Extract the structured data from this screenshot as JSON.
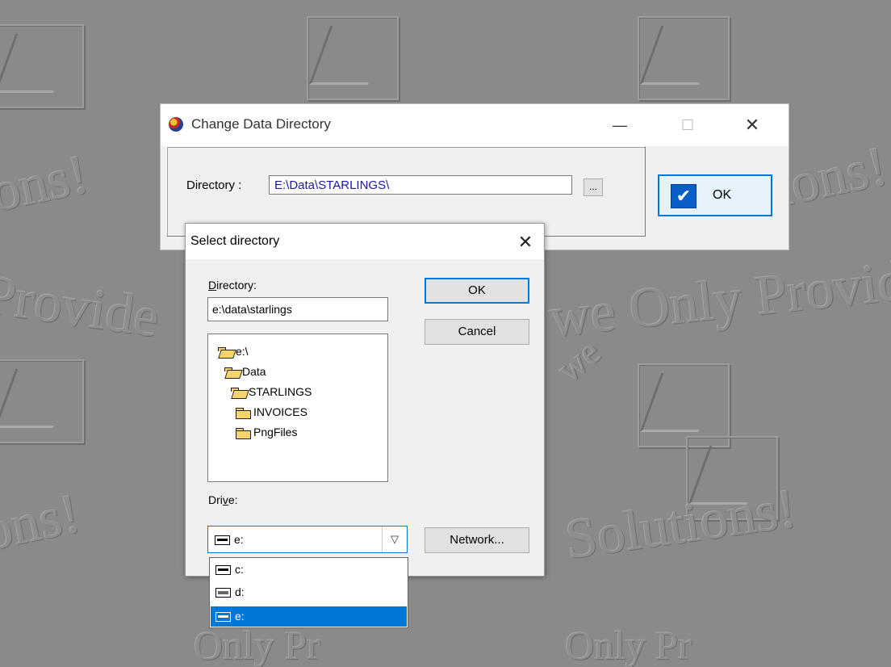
{
  "main_window": {
    "title": "Change Data Directory",
    "minimize": "—",
    "maximize": "☐",
    "close": "✕",
    "directory_label": "Directory :",
    "directory_value": "E:\\Data\\STARLINGS\\",
    "browse_label": "...",
    "ok_label": "OK"
  },
  "select_dialog": {
    "title": "Select directory",
    "close": "✕",
    "directory_label_first": "D",
    "directory_label_rest": "irectory:",
    "path_value": "e:\\data\\starlings",
    "tree": [
      {
        "label": "e:\\",
        "indent": 0,
        "icon": "folder-open-icon"
      },
      {
        "label": "Data",
        "indent": 1,
        "icon": "folder-open-icon"
      },
      {
        "label": "STARLINGS",
        "indent": 2,
        "icon": "folder-open-icon"
      },
      {
        "label": "INVOICES",
        "indent": 3,
        "icon": "folder-icon"
      },
      {
        "label": "PngFiles",
        "indent": 3,
        "icon": "folder-icon"
      }
    ],
    "ok_label": "OK",
    "cancel_label": "Cancel",
    "drive_label_first": "Dri",
    "drive_label_u": "v",
    "drive_label_rest": "e:",
    "drive_selected": "e:",
    "network_label": "Network...",
    "drive_options": [
      {
        "label": "c:",
        "icon": "hard-drive-icon",
        "selected": false
      },
      {
        "label": "d:",
        "icon": "cd-drive-icon",
        "selected": false
      },
      {
        "label": "e:",
        "icon": "hard-drive-icon",
        "selected": true
      }
    ]
  },
  "wallpaper": {
    "text_a": "ions!",
    "text_b": "Provide",
    "text_c": "we Only Provide",
    "text_d": "Solutions!",
    "text_e": "we",
    "text_f": "Only Pr"
  }
}
